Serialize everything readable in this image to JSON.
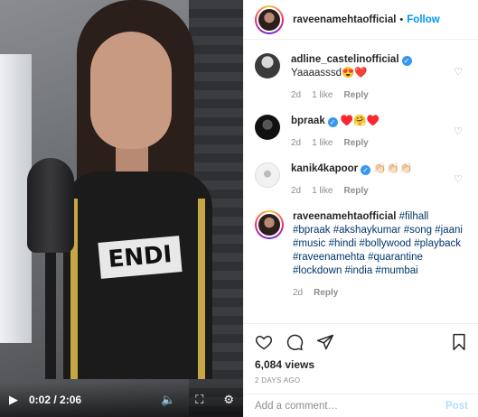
{
  "video": {
    "shirt_logo": "ENDI",
    "play_icon": "▶",
    "time": "0:02 / 2:06",
    "volume_icon": "🔈",
    "fullscreen_icon": "⛶",
    "settings_icon": "⚙"
  },
  "header": {
    "username": "raveenamehtaofficial",
    "dot": "•",
    "follow_label": "Follow"
  },
  "comments": [
    {
      "username": "adline_castelinofficial",
      "verified": true,
      "text": "Yaaaasssd😍❤️",
      "time": "2d",
      "likes": "1 like",
      "reply": "Reply"
    },
    {
      "username": "bpraak",
      "verified": true,
      "text": "♥️🤗♥️",
      "time": "2d",
      "likes": "1 like",
      "reply": "Reply"
    },
    {
      "username": "kanik4kapoor",
      "verified": true,
      "text": "👏🏻👏🏻👏🏻",
      "time": "2d",
      "likes": "1 like",
      "reply": "Reply"
    }
  ],
  "caption": {
    "username": "raveenamehtaofficial",
    "hashtags": "#filhall #bpraak #akshaykumar #song #jaani #music #hindi #bollywood #playback #raveenamehta #quarantine #lockdown #india #mumbai",
    "time": "2d",
    "reply": "Reply"
  },
  "actions": {
    "views": "6,084 views",
    "posted": "2 DAYS AGO"
  },
  "add_comment": {
    "placeholder": "Add a comment…",
    "post_label": "Post"
  },
  "colors": {
    "accent": "#0095f6",
    "verified": "#3897f0",
    "muted": "#8e8e8e",
    "hashtag": "#00376b"
  }
}
